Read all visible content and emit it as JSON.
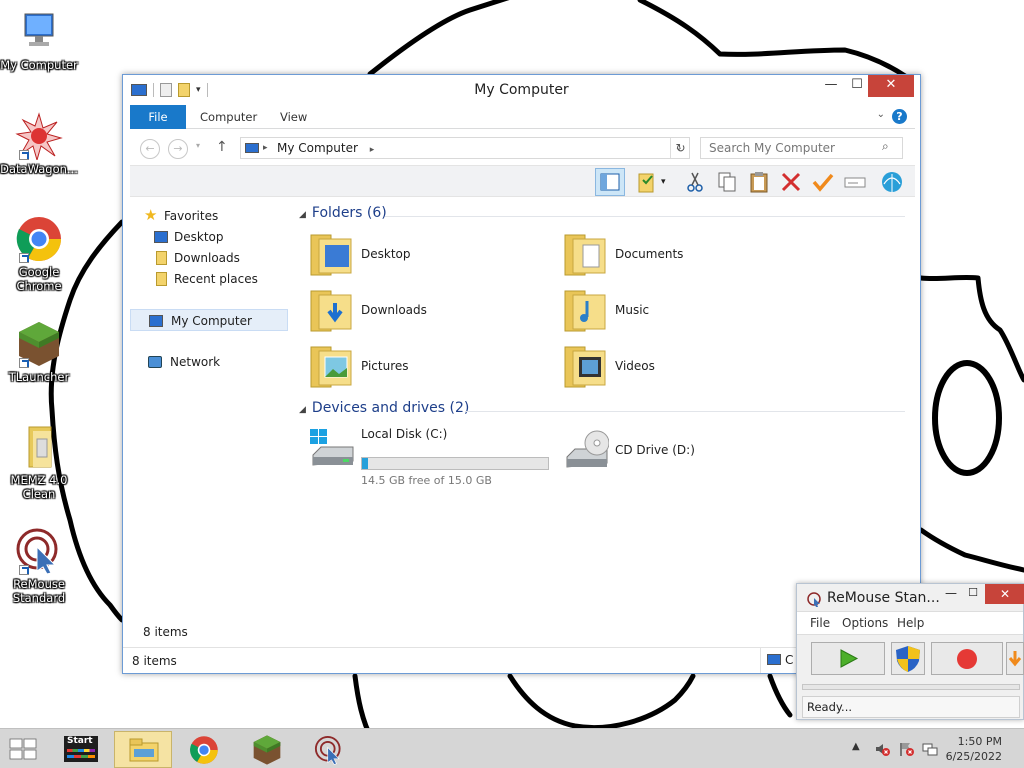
{
  "desktop": {
    "icons": [
      {
        "label": "My Computer"
      },
      {
        "label": "DataWagon..."
      },
      {
        "label": "Google Chrome"
      },
      {
        "label": "TLauncher"
      },
      {
        "label": "MEMZ 4.0 Clean"
      },
      {
        "label": "ReMouse Standard"
      }
    ]
  },
  "explorer": {
    "title": "My Computer",
    "tabs": {
      "file": "File",
      "computer": "Computer",
      "view": "View"
    },
    "address": "My Computer",
    "search_placeholder": "Search My Computer",
    "nav": {
      "favorites": "Favorites",
      "desktop": "Desktop",
      "downloads": "Downloads",
      "recent": "Recent places",
      "my_computer": "My Computer",
      "network": "Network"
    },
    "folders_header": "Folders (6)",
    "folders": [
      {
        "name": "Desktop"
      },
      {
        "name": "Documents"
      },
      {
        "name": "Downloads"
      },
      {
        "name": "Music"
      },
      {
        "name": "Pictures"
      },
      {
        "name": "Videos"
      }
    ],
    "drives_header": "Devices and drives (2)",
    "drives": [
      {
        "name": "Local Disk (C:)",
        "free": "14.5 GB free of 15.0 GB",
        "used_fraction": 0.033
      },
      {
        "name": "CD Drive (D:)"
      }
    ],
    "item_count": "8 items",
    "status_text": "8 items",
    "status_right": "C"
  },
  "remouse": {
    "title": "ReMouse Stan...",
    "menu": {
      "file": "File",
      "options": "Options",
      "help": "Help"
    },
    "status": "Ready..."
  },
  "taskbar": {
    "start_label": "Start",
    "time": "1:50 PM",
    "date": "6/25/2022"
  },
  "colors": {
    "accent": "#1979ca",
    "close_red": "#c7443a",
    "folder_yellow": "#f3d36b",
    "header_blue": "#1e3f8a"
  }
}
